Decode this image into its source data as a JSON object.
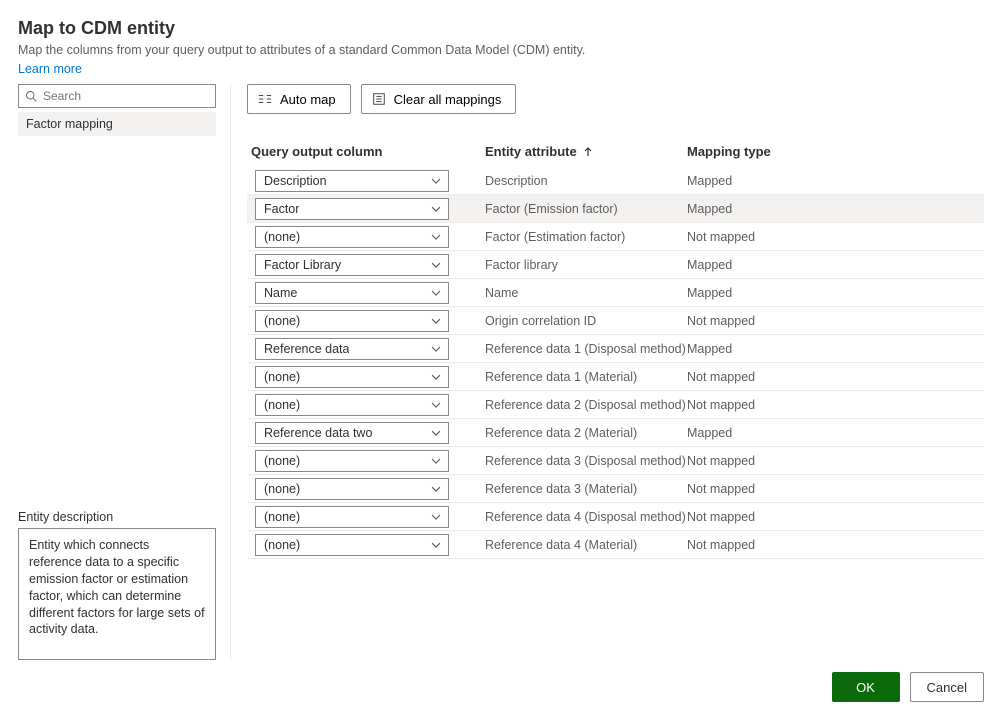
{
  "header": {
    "title": "Map to CDM entity",
    "subtitle": "Map the columns from your query output to attributes of a standard Common Data Model (CDM) entity.",
    "learn_more": "Learn more"
  },
  "sidebar": {
    "search_placeholder": "Search",
    "items": [
      {
        "label": "Factor mapping"
      }
    ],
    "entity_desc_label": "Entity description",
    "entity_desc_text": "Entity which connects reference data to a specific emission factor or estimation factor, which can determine different factors for large sets of activity data."
  },
  "toolbar": {
    "auto_map": "Auto map",
    "clear_all": "Clear all mappings"
  },
  "grid": {
    "headers": {
      "query": "Query output column",
      "attribute": "Entity attribute",
      "mapping_type": "Mapping type"
    },
    "rows": [
      {
        "query": "Description",
        "attribute": "Description",
        "mapping": "Mapped",
        "highlight": false
      },
      {
        "query": "Factor",
        "attribute": "Factor (Emission factor)",
        "mapping": "Mapped",
        "highlight": true
      },
      {
        "query": "(none)",
        "attribute": "Factor (Estimation factor)",
        "mapping": "Not mapped",
        "highlight": false
      },
      {
        "query": "Factor Library",
        "attribute": "Factor library",
        "mapping": "Mapped",
        "highlight": false
      },
      {
        "query": "Name",
        "attribute": "Name",
        "mapping": "Mapped",
        "highlight": false
      },
      {
        "query": "(none)",
        "attribute": "Origin correlation ID",
        "mapping": "Not mapped",
        "highlight": false
      },
      {
        "query": "Reference data",
        "attribute": "Reference data 1 (Disposal method)",
        "mapping": "Mapped",
        "highlight": false
      },
      {
        "query": "(none)",
        "attribute": "Reference data 1 (Material)",
        "mapping": "Not mapped",
        "highlight": false
      },
      {
        "query": "(none)",
        "attribute": "Reference data 2 (Disposal method)",
        "mapping": "Not mapped",
        "highlight": false
      },
      {
        "query": "Reference data two",
        "attribute": "Reference data 2 (Material)",
        "mapping": "Mapped",
        "highlight": false
      },
      {
        "query": "(none)",
        "attribute": "Reference data 3 (Disposal method)",
        "mapping": "Not mapped",
        "highlight": false
      },
      {
        "query": "(none)",
        "attribute": "Reference data 3 (Material)",
        "mapping": "Not mapped",
        "highlight": false
      },
      {
        "query": "(none)",
        "attribute": "Reference data 4 (Disposal method)",
        "mapping": "Not mapped",
        "highlight": false
      },
      {
        "query": "(none)",
        "attribute": "Reference data 4 (Material)",
        "mapping": "Not mapped",
        "highlight": false
      }
    ]
  },
  "footer": {
    "ok": "OK",
    "cancel": "Cancel"
  }
}
